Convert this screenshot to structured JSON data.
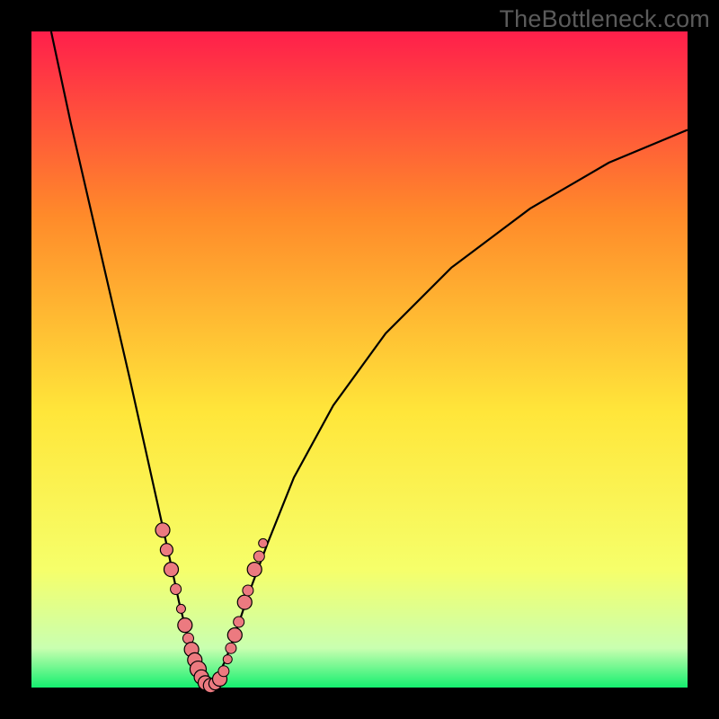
{
  "watermark": "TheBottleneck.com",
  "colors": {
    "top": "#ff1f4b",
    "mid_upper": "#ff8a2a",
    "mid": "#ffe63a",
    "lower": "#f6ff6a",
    "band_light": "#c9ffb0",
    "bottom": "#15ef6f",
    "curve": "#000000",
    "dot_fill": "#ec7a80",
    "dot_stroke": "#000000",
    "frame": "#000000"
  },
  "chart_data": {
    "type": "line",
    "title": "",
    "xlabel": "",
    "ylabel": "",
    "xlim": [
      0,
      100
    ],
    "ylim": [
      0,
      100
    ],
    "series": [
      {
        "name": "bottleneck-curve-left",
        "x": [
          3,
          6,
          9,
          12,
          15,
          17,
          19,
          21,
          22.5,
          24,
          25,
          26,
          27
        ],
        "y": [
          100,
          86,
          73,
          60,
          47,
          38,
          29,
          20,
          13,
          7,
          3,
          1,
          0
        ]
      },
      {
        "name": "bottleneck-curve-right",
        "x": [
          27,
          28,
          29.5,
          31,
          33,
          36,
          40,
          46,
          54,
          64,
          76,
          88,
          100
        ],
        "y": [
          0,
          1,
          4,
          8,
          14,
          22,
          32,
          43,
          54,
          64,
          73,
          80,
          85
        ]
      }
    ],
    "marker_clusters": [
      {
        "name": "left-cluster",
        "points": [
          {
            "x": 20.0,
            "y": 24.0,
            "r": 8
          },
          {
            "x": 20.6,
            "y": 21.0,
            "r": 7
          },
          {
            "x": 21.3,
            "y": 18.0,
            "r": 8
          },
          {
            "x": 22.0,
            "y": 15.0,
            "r": 6
          },
          {
            "x": 22.8,
            "y": 12.0,
            "r": 5
          },
          {
            "x": 23.4,
            "y": 9.5,
            "r": 8
          },
          {
            "x": 23.9,
            "y": 7.5,
            "r": 6
          },
          {
            "x": 24.4,
            "y": 5.8,
            "r": 8
          },
          {
            "x": 24.9,
            "y": 4.2,
            "r": 8
          },
          {
            "x": 25.4,
            "y": 2.8,
            "r": 9
          },
          {
            "x": 25.9,
            "y": 1.6,
            "r": 8
          }
        ]
      },
      {
        "name": "bottom-cluster",
        "points": [
          {
            "x": 26.5,
            "y": 0.7,
            "r": 8
          },
          {
            "x": 27.3,
            "y": 0.3,
            "r": 8
          },
          {
            "x": 28.0,
            "y": 0.6,
            "r": 7
          },
          {
            "x": 28.7,
            "y": 1.3,
            "r": 8
          }
        ]
      },
      {
        "name": "right-cluster",
        "points": [
          {
            "x": 29.3,
            "y": 2.5,
            "r": 6
          },
          {
            "x": 29.9,
            "y": 4.3,
            "r": 5
          },
          {
            "x": 30.4,
            "y": 6.0,
            "r": 6
          },
          {
            "x": 31.0,
            "y": 8.0,
            "r": 8
          },
          {
            "x": 31.6,
            "y": 10.0,
            "r": 6
          },
          {
            "x": 32.5,
            "y": 13.0,
            "r": 8
          },
          {
            "x": 33.0,
            "y": 14.8,
            "r": 6
          },
          {
            "x": 34.0,
            "y": 18.0,
            "r": 8
          },
          {
            "x": 34.7,
            "y": 20.0,
            "r": 6
          },
          {
            "x": 35.3,
            "y": 22.0,
            "r": 5
          }
        ]
      }
    ]
  }
}
